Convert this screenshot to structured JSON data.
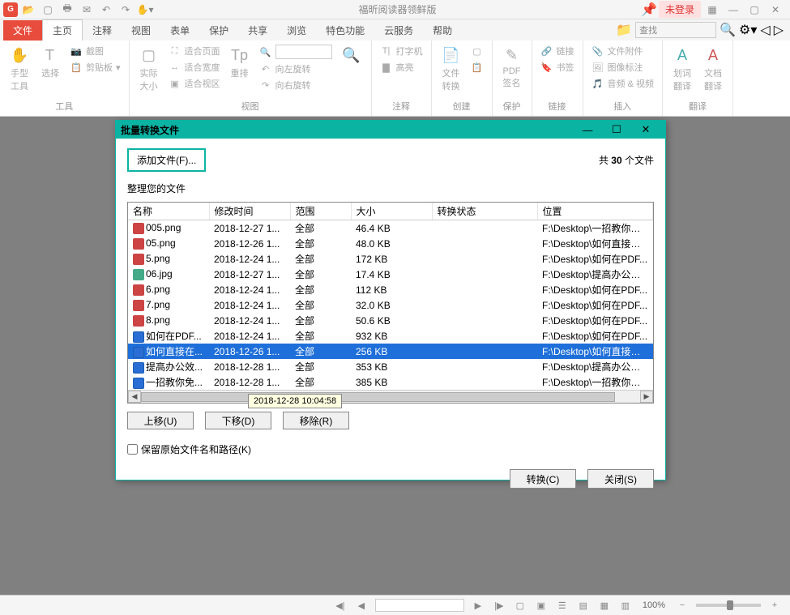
{
  "app": {
    "title": "福昕阅读器领鲜版",
    "login_label": "未登录"
  },
  "tabs": {
    "file": "文件",
    "home": "主页",
    "annotate": "注释",
    "view": "视图",
    "form": "表单",
    "protect": "保护",
    "share": "共享",
    "browse": "浏览",
    "feature": "特色功能",
    "cloud": "云服务",
    "help": "帮助"
  },
  "search": {
    "placeholder": "查找"
  },
  "ribbon": {
    "tool": {
      "hand": "手型\n工具",
      "select": "选择",
      "group": "工具"
    },
    "clipboard": {
      "snapshot": "截图",
      "clipboard": "剪贴板"
    },
    "size": {
      "actual": "实际\n大小",
      "fit_page": "适合页面",
      "fit_width": "适合宽度",
      "fit_vis": "适合视区"
    },
    "rotate": {
      "reflow": "重排",
      "left": "向左旋转",
      "right": "向右旋转",
      "group": "视图"
    },
    "annot": {
      "typewriter": "打字机",
      "highlight": "高亮",
      "group": "注释"
    },
    "convert": {
      "file": "文件\n转换",
      "group": "创建"
    },
    "sign": {
      "pdf": "PDF\n签名",
      "group": "保护"
    },
    "link": {
      "link": "链接",
      "bookmark": "书签",
      "group": "链接"
    },
    "attach": {
      "attach": "文件附件",
      "image": "图像标注",
      "av": "音频 & 视频",
      "group": "插入"
    },
    "translate": {
      "word": "划词\n翻译",
      "doc": "文档\n翻译",
      "group": "翻译"
    }
  },
  "dialog": {
    "title": "批量转换文件",
    "add_file": "添加文件(F)...",
    "count_prefix": "共 ",
    "count": "30",
    "count_suffix": " 个文件",
    "organize": "整理您的文件",
    "columns": {
      "name": "名称",
      "modified": "修改时间",
      "scope": "范围",
      "size": "大小",
      "status": "转换状态",
      "location": "位置"
    },
    "rows": [
      {
        "icon": "png",
        "name": "005.png",
        "modified": "2018-12-27 1...",
        "scope": "全部",
        "size": "46.4 KB",
        "status": "",
        "location": "F:\\Desktop\\一招教你免..."
      },
      {
        "icon": "png",
        "name": "05.png",
        "modified": "2018-12-26 1...",
        "scope": "全部",
        "size": "48.0 KB",
        "status": "",
        "location": "F:\\Desktop\\如何直接在..."
      },
      {
        "icon": "png",
        "name": "5.png",
        "modified": "2018-12-24 1...",
        "scope": "全部",
        "size": "172 KB",
        "status": "",
        "location": "F:\\Desktop\\如何在PDF..."
      },
      {
        "icon": "jpg",
        "name": "06.jpg",
        "modified": "2018-12-27 1...",
        "scope": "全部",
        "size": "17.4 KB",
        "status": "",
        "location": "F:\\Desktop\\提高办公效..."
      },
      {
        "icon": "png",
        "name": "6.png",
        "modified": "2018-12-24 1...",
        "scope": "全部",
        "size": "112 KB",
        "status": "",
        "location": "F:\\Desktop\\如何在PDF..."
      },
      {
        "icon": "png",
        "name": "7.png",
        "modified": "2018-12-24 1...",
        "scope": "全部",
        "size": "32.0 KB",
        "status": "",
        "location": "F:\\Desktop\\如何在PDF..."
      },
      {
        "icon": "png",
        "name": "8.png",
        "modified": "2018-12-24 1...",
        "scope": "全部",
        "size": "50.6 KB",
        "status": "",
        "location": "F:\\Desktop\\如何在PDF..."
      },
      {
        "icon": "doc",
        "name": "如何在PDF...",
        "modified": "2018-12-24 1...",
        "scope": "全部",
        "size": "932 KB",
        "status": "",
        "location": "F:\\Desktop\\如何在PDF..."
      },
      {
        "icon": "doc",
        "name": "如何直接在...",
        "modified": "2018-12-26 1...",
        "scope": "全部",
        "size": "256 KB",
        "status": "",
        "location": "F:\\Desktop\\如何直接在...",
        "selected": true
      },
      {
        "icon": "doc",
        "name": "提高办公效...",
        "modified": "2018-12-28 1...",
        "scope": "全部",
        "size": "353 KB",
        "status": "",
        "location": "F:\\Desktop\\提高办公效..."
      },
      {
        "icon": "doc",
        "name": "一招教你免...",
        "modified": "2018-12-28 1...",
        "scope": "全部",
        "size": "385 KB",
        "status": "",
        "location": "F:\\Desktop\\一招教你免..."
      }
    ],
    "tooltip": "2018-12-28 10:04:58",
    "move_up": "上移(U)",
    "move_down": "下移(D)",
    "remove": "移除(R)",
    "keep_path": "保留原始文件名和路径(K)",
    "convert": "转换(C)",
    "close": "关闭(S)"
  },
  "statusbar": {
    "zoom": "100%"
  }
}
